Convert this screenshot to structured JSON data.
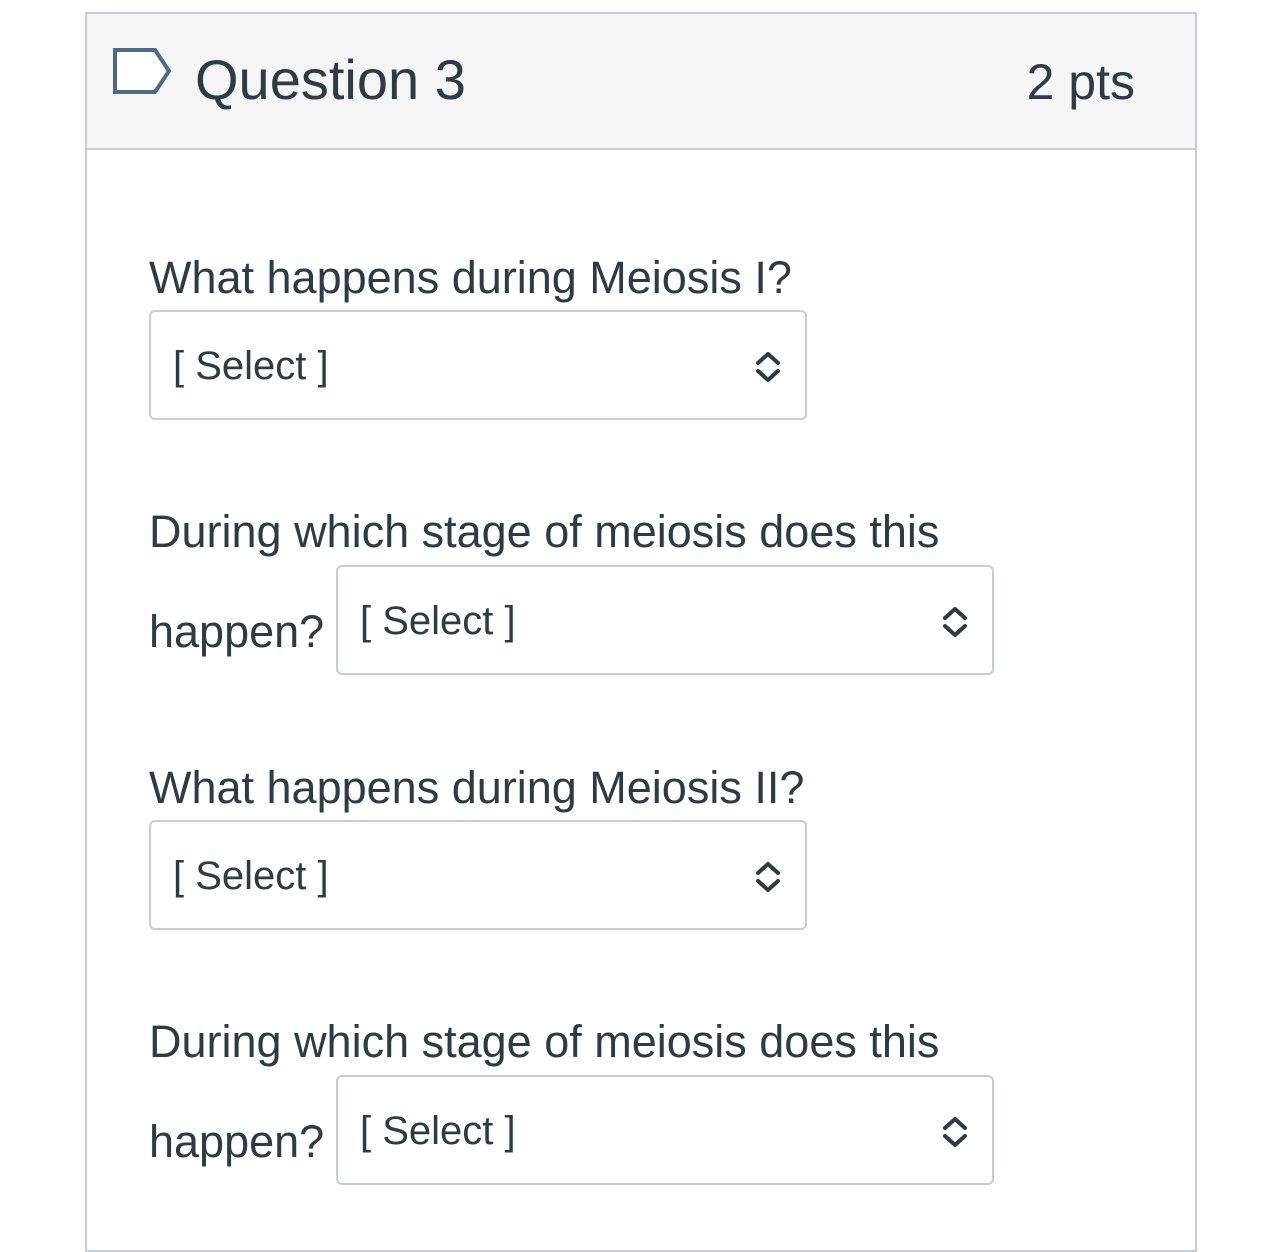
{
  "question": {
    "title": "Question 3",
    "points": "2 pts",
    "flag_icon": "flag-outline-icon"
  },
  "items": [
    {
      "prompt": "What happens during Meiosis I?",
      "select_value": "[ Select ]"
    },
    {
      "prompt_line1": "During which stage of meiosis does this",
      "prompt_line2": "happen?",
      "select_value": "[ Select ]"
    },
    {
      "prompt": "What happens during Meiosis II?",
      "select_value": "[ Select ]"
    },
    {
      "prompt_line1": "During which stage of meiosis does this",
      "prompt_line2": "happen?",
      "select_value": "[ Select ]"
    }
  ],
  "colors": {
    "text": "#2d3b45",
    "border": "#c7cdd1",
    "header_bg": "#f5f5f5"
  }
}
